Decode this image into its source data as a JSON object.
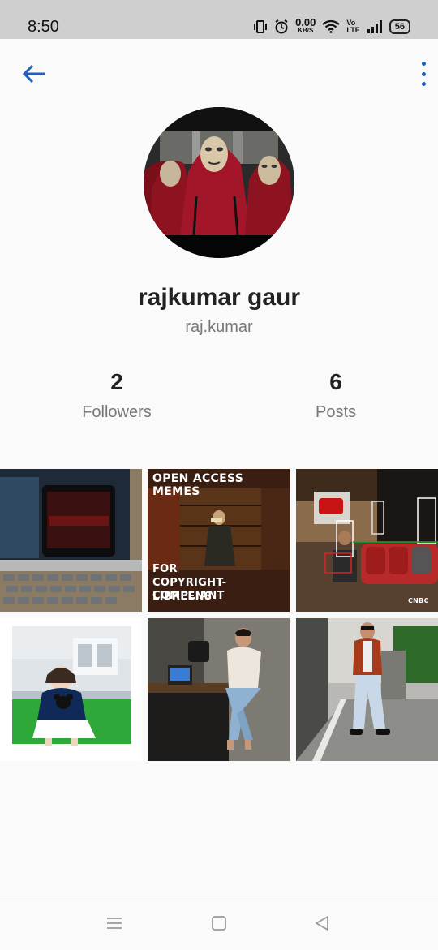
{
  "status_bar": {
    "time": "8:50",
    "net_speed_value": "0.00",
    "net_speed_unit": "KB/S",
    "volte_top": "Vo",
    "volte_bottom": "LTE",
    "battery": "56"
  },
  "app_bar": {
    "back_icon": "arrow-back-icon",
    "more_icon": "more-vertical-icon"
  },
  "profile": {
    "name": "rajkumar gaur",
    "username": "raj.kumar"
  },
  "stats": {
    "followers_count": "2",
    "followers_label": "Followers",
    "posts_count": "6",
    "posts_label": "Posts"
  },
  "posts": {
    "meme_title": "OPEN ACCESS MEMES",
    "meme_caption_1": "FOR",
    "meme_caption_2": "COPYRIGHT-COMPLIANT",
    "meme_caption_3": "LIBREENS",
    "news_watermark": "CNBC"
  },
  "colors": {
    "accent": "#1f5fbf",
    "status_bar_bg": "#cfcfcf",
    "page_bg": "#fafafa"
  },
  "nav_bar": {
    "menu_icon": "menu-icon",
    "home_icon": "home-square-icon",
    "back_icon": "back-triangle-icon"
  }
}
